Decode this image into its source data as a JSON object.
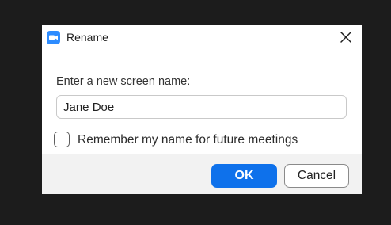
{
  "dialog": {
    "title": "Rename",
    "app_icon": "zoom-camera-icon",
    "close_icon": "close-icon",
    "prompt": "Enter a new screen name:",
    "name_value": "Jane Doe",
    "remember_label": "Remember my name for future meetings",
    "remember_checked": false,
    "ok_label": "OK",
    "cancel_label": "Cancel"
  },
  "colors": {
    "accent": "#0e71eb",
    "app_icon": "#2d8cff",
    "background": "#1c1c1c",
    "footer": "#f2f2f2"
  }
}
